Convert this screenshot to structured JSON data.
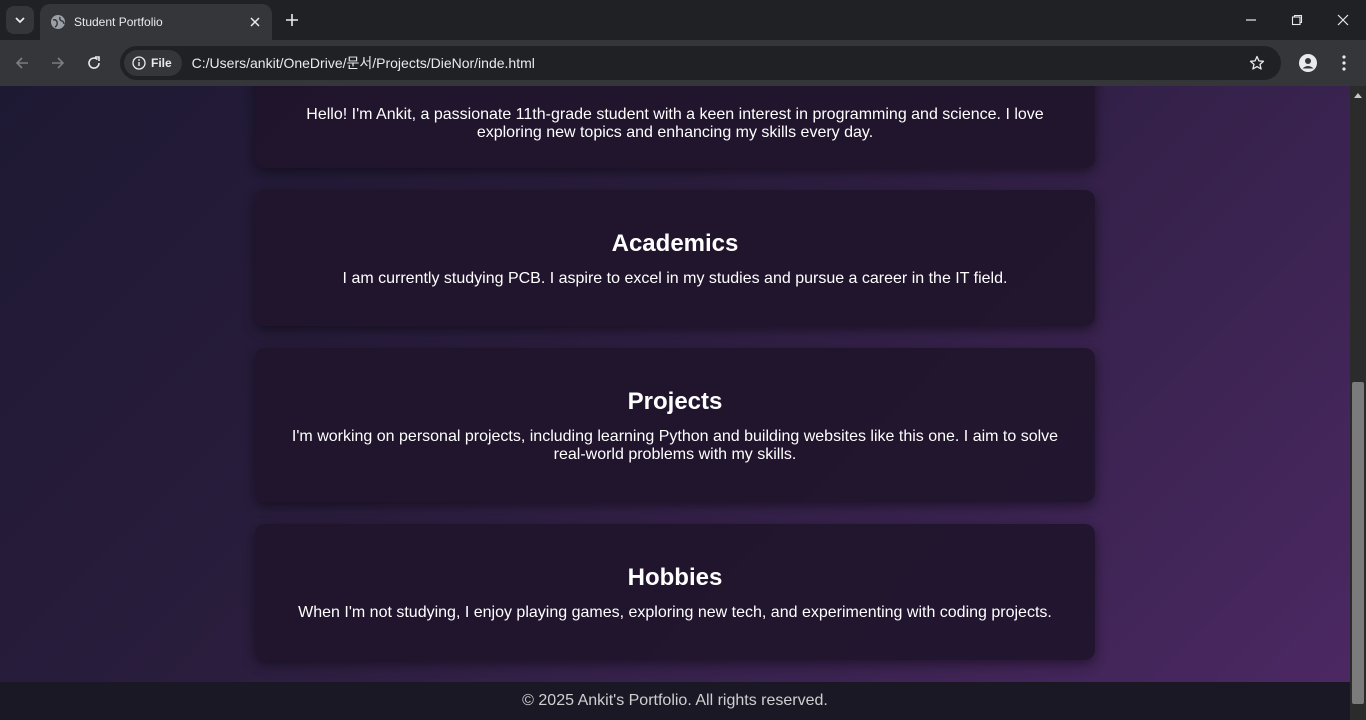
{
  "browser": {
    "tab_title": "Student Portfolio",
    "address_chip": "File",
    "url": "C:/Users/ankit/OneDrive/문서/Projects/DieNor/inde.html"
  },
  "page": {
    "about": {
      "text": "Hello! I'm Ankit, a passionate 11th-grade student with a keen interest in programming and science. I love exploring new topics and enhancing my skills every day."
    },
    "academics": {
      "heading": "Academics",
      "text": "I am currently studying PCB. I aspire to excel in my studies and pursue a career in the IT field."
    },
    "projects": {
      "heading": "Projects",
      "text": "I'm working on personal projects, including learning Python and building websites like this one. I aim to solve real-world problems with my skills."
    },
    "hobbies": {
      "heading": "Hobbies",
      "text": "When I'm not studying, I enjoy playing games, exploring new tech, and experimenting with coding projects."
    },
    "footer": "© 2025 Ankit's Portfolio. All rights reserved."
  },
  "icons": {
    "tab_search": "chevron-down-icon",
    "favicon": "globe-icon",
    "close": "close-icon",
    "new_tab": "plus-icon",
    "back": "arrow-left-icon",
    "forward": "arrow-right-icon",
    "reload": "reload-icon",
    "info": "info-icon",
    "bookmark": "star-icon",
    "profile": "profile-icon",
    "menu": "kebab-menu-icon"
  },
  "colors": {
    "chrome_dark": "#202124",
    "chrome_toolbar": "#35363a",
    "card_bg": "#20142c",
    "footer_bg": "#1b1826",
    "text": "#ffffff"
  }
}
